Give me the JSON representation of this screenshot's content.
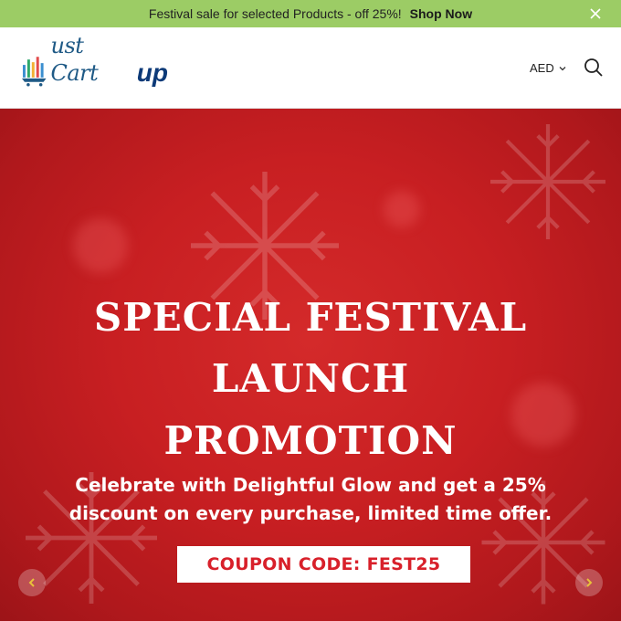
{
  "announcement": {
    "text": "Festival sale for selected Products - off 25%!",
    "link_label": "Shop Now",
    "close_icon": "close-icon"
  },
  "header": {
    "logo": {
      "main_text": "ust Cart",
      "accent_text": "up"
    },
    "currency": "AED",
    "search_icon": "search-icon"
  },
  "hero": {
    "headline_lines": [
      "SPECIAL FESTIVAL",
      "LAUNCH",
      "PROMOTION"
    ],
    "subtext_lines": [
      "Celebrate with Delightful Glow and get a 25%",
      "discount on every purchase, limited time offer."
    ],
    "coupon": "COUPON CODE: FEST25",
    "prev_icon": "chevron-left-icon",
    "next_icon": "chevron-right-icon"
  },
  "colors": {
    "announcement_bg": "#9ccc65",
    "hero_red": "#c81f22",
    "coupon_text": "#d8202a",
    "logo_blue": "#1f5a86",
    "arrow_accent": "#e8c23a"
  }
}
